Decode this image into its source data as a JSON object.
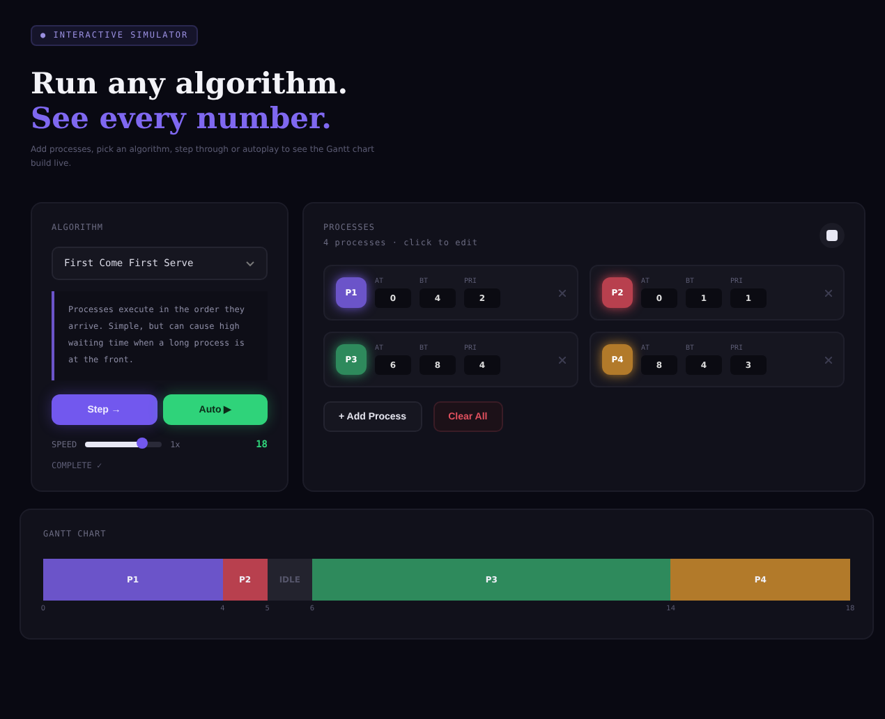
{
  "badge": "● INTERACTIVE SIMULATOR",
  "headline": {
    "line1": "Run any algorithm.",
    "line2": "See every number."
  },
  "subtitle": "Add processes, pick an algorithm, step through or autoplay to see the Gantt chart build live.",
  "algorithm_panel": {
    "label": "ALGORITHM",
    "select": {
      "value": "First Come First Serve"
    },
    "description": "Processes execute in the order they arrive. Simple, but can cause high waiting time when a long process is at the front.",
    "step_button": "Step →",
    "auto_button": "Auto ▶",
    "speed": {
      "label": "SPEED",
      "reading": "1x"
    },
    "clock": "18",
    "status": "COMPLETE ✓"
  },
  "processes_panel": {
    "title": "PROCESSES",
    "summary": "4 processes · click to edit",
    "processes": [
      {
        "name": "P1",
        "color": "#6b54c9",
        "fields": [
          {
            "label": "AT",
            "value": "0"
          },
          {
            "label": "BT",
            "value": "4"
          },
          {
            "label": "PRI",
            "value": "2"
          }
        ]
      },
      {
        "name": "P2",
        "color": "#b8404e",
        "fields": [
          {
            "label": "AT",
            "value": "0"
          },
          {
            "label": "BT",
            "value": "1"
          },
          {
            "label": "PRI",
            "value": "1"
          }
        ]
      },
      {
        "name": "P3",
        "color": "#2e8a5c",
        "fields": [
          {
            "label": "AT",
            "value": "6"
          },
          {
            "label": "BT",
            "value": "8"
          },
          {
            "label": "PRI",
            "value": "4"
          }
        ]
      },
      {
        "name": "P4",
        "color": "#b27a2a",
        "fields": [
          {
            "label": "AT",
            "value": "8"
          },
          {
            "label": "BT",
            "value": "4"
          },
          {
            "label": "PRI",
            "value": "3"
          }
        ]
      }
    ],
    "add_button": "+ Add Process",
    "clear_button": "Clear All"
  },
  "gantt": {
    "title": "GANTT CHART",
    "segments": [
      {
        "label": "P1",
        "kind": "process",
        "color": "#6b54c9"
      },
      {
        "label": "P2",
        "kind": "process",
        "color": "#b8404e"
      },
      {
        "label": "IDLE",
        "kind": "idle",
        "color": "#23232e"
      },
      {
        "label": "P3",
        "kind": "process",
        "color": "#2e8a5c"
      },
      {
        "label": "P4",
        "kind": "process",
        "color": "#b27a2a"
      }
    ],
    "ticks": [
      "0",
      "4",
      "5",
      "6",
      "14",
      "18"
    ]
  }
}
